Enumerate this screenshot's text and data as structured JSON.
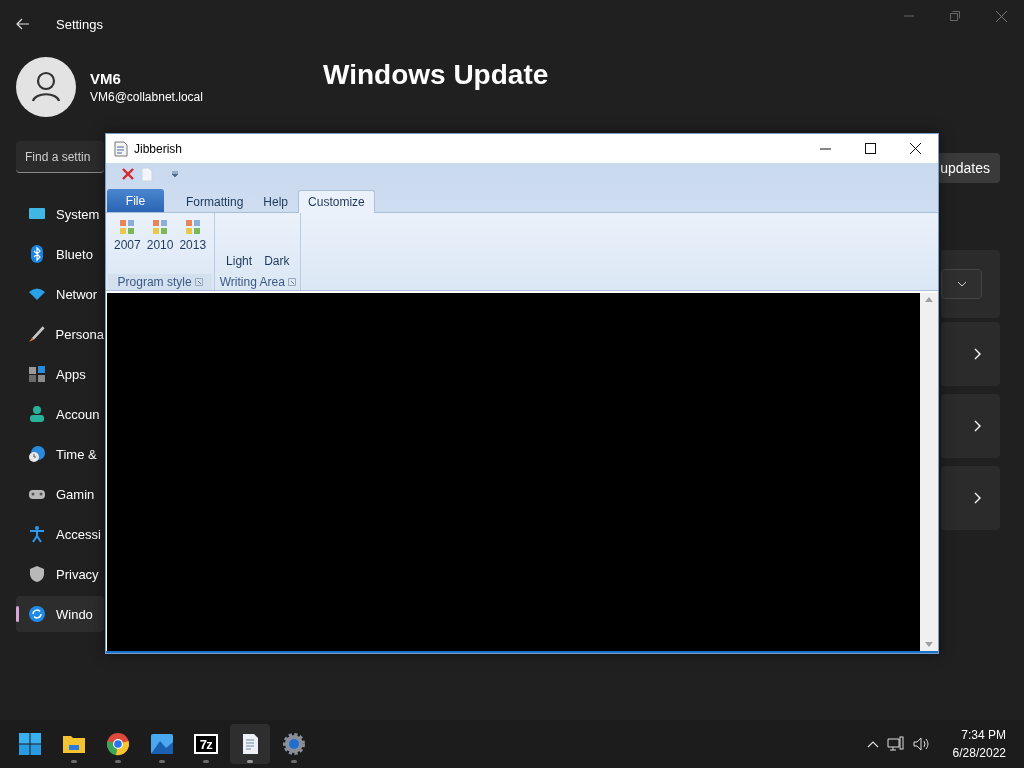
{
  "settings": {
    "title": "Settings",
    "user": {
      "name": "VM6",
      "email": "VM6@collabnet.local"
    },
    "search": {
      "placeholder": "Find a settin"
    },
    "nav": [
      {
        "kind": "system",
        "label": "System",
        "selected": false
      },
      {
        "kind": "bluetooth",
        "label": "Blueto",
        "selected": false
      },
      {
        "kind": "network",
        "label": "Networ",
        "selected": false
      },
      {
        "kind": "personalize",
        "label": "Persona",
        "selected": false
      },
      {
        "kind": "apps",
        "label": "Apps",
        "selected": false
      },
      {
        "kind": "accounts",
        "label": "Accoun",
        "selected": false
      },
      {
        "kind": "time",
        "label": "Time &",
        "selected": false
      },
      {
        "kind": "gaming",
        "label": "Gamin",
        "selected": false
      },
      {
        "kind": "accessibility",
        "label": "Accessi",
        "selected": false
      },
      {
        "kind": "privacy",
        "label": "Privacy",
        "selected": false
      },
      {
        "kind": "update",
        "label": "Windo",
        "selected": true
      }
    ],
    "page_title": "Windows Update",
    "action_button": "updates",
    "cards": [
      {
        "kind": "dropdown"
      },
      {
        "kind": "link"
      },
      {
        "kind": "link"
      },
      {
        "kind": "link"
      }
    ]
  },
  "app": {
    "title": "Jibberish",
    "tabs": [
      {
        "kind": "app",
        "label": "File",
        "selected": false
      },
      {
        "kind": "tab",
        "label": "Formatting",
        "selected": false
      },
      {
        "kind": "tab",
        "label": "Help",
        "selected": false
      },
      {
        "kind": "tab",
        "label": "Customize",
        "selected": true
      }
    ],
    "groups": [
      {
        "kind": "icon",
        "label": "Program style",
        "buttons": [
          "2007",
          "2010",
          "2013"
        ]
      },
      {
        "kind": "text",
        "label": "Writing Area",
        "buttons": [
          "Light",
          "Dark"
        ]
      }
    ]
  },
  "taskbar": {
    "apps": [
      {
        "kind": "start",
        "active": false
      },
      {
        "kind": "folder",
        "active": false
      },
      {
        "kind": "browser",
        "active": false
      },
      {
        "kind": "photos",
        "active": false
      },
      {
        "kind": "archiver",
        "label": "7z",
        "active": false
      },
      {
        "kind": "notepad",
        "active": true
      },
      {
        "kind": "settings",
        "active": false
      }
    ],
    "time": "7:34 PM",
    "date": "6/28/2022"
  }
}
